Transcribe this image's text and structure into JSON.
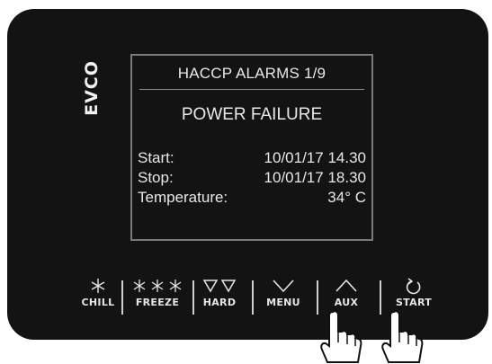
{
  "brand": {
    "logo_text": "EVCO"
  },
  "screen": {
    "title": "HACCP ALARMS 1/9",
    "alarm": "POWER FAILURE",
    "rows": [
      {
        "label": "Start:",
        "value": "10/01/17 14.30"
      },
      {
        "label": "Stop:",
        "value": "10/01/17 18.30"
      },
      {
        "label": "Temperature:",
        "value": "34° C"
      }
    ]
  },
  "buttons": [
    {
      "label": "CHILL",
      "icon": "snowflake-icon"
    },
    {
      "label": "FREEZE",
      "icon": "triple-snowflake-icon"
    },
    {
      "label": "HARD",
      "icon": "double-down-triangle-icon"
    },
    {
      "label": "MENU",
      "icon": "chevron-down-icon"
    },
    {
      "label": "AUX",
      "icon": "chevron-up-icon"
    },
    {
      "label": "START",
      "icon": "restart-icon"
    }
  ],
  "colors": {
    "panel": "#131313",
    "text": "#e8e8e8",
    "border": "#7a7a7a"
  }
}
